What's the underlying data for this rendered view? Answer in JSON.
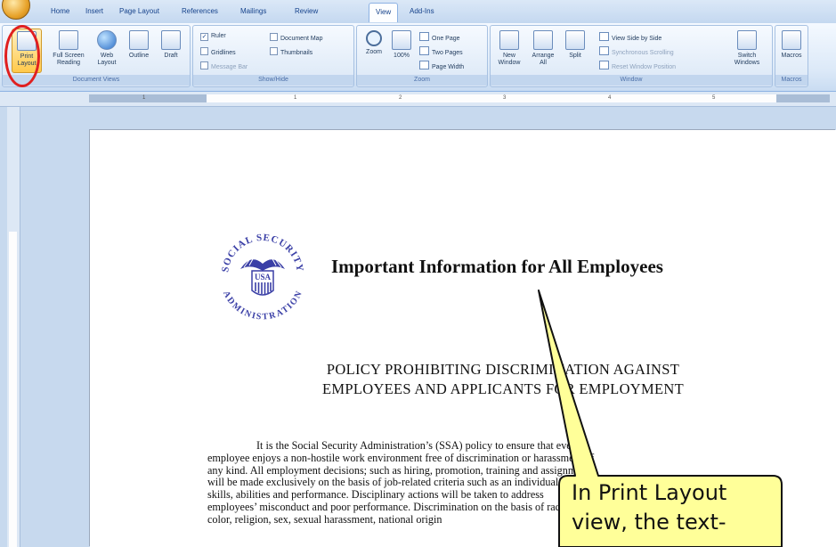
{
  "ribbon": {
    "tabs": [
      "Home",
      "Insert",
      "Page Layout",
      "References",
      "Mailings",
      "Review",
      "View",
      "Add-Ins"
    ],
    "active_tab": "View",
    "document_views": {
      "label": "Document Views",
      "buttons": [
        "Print Layout",
        "Full Screen Reading",
        "Web Layout",
        "Outline",
        "Draft"
      ]
    },
    "show_hide": {
      "label": "Show/Hide",
      "items": [
        {
          "label": "Ruler",
          "checked": true
        },
        {
          "label": "Gridlines",
          "checked": false
        },
        {
          "label": "Message Bar",
          "checked": false
        },
        {
          "label": "Document Map",
          "checked": false
        },
        {
          "label": "Thumbnails",
          "checked": false
        }
      ]
    },
    "zoom": {
      "label": "Zoom",
      "zoom_button": "Zoom",
      "hundred_button": "100%",
      "one_page": "One Page",
      "two_pages": "Two Pages",
      "page_width": "Page Width"
    },
    "window": {
      "label": "Window",
      "new_window": "New Window",
      "arrange_all": "Arrange All",
      "split": "Split",
      "view_side_by_side": "View Side by Side",
      "synchronous_scrolling": "Synchronous Scrolling",
      "reset_window_position": "Reset Window Position",
      "switch_windows": "Switch Windows"
    },
    "macros": {
      "label": "Macros",
      "button": "Macros"
    }
  },
  "ruler": {
    "numbers": [
      "1",
      "1",
      "2",
      "3",
      "4",
      "5"
    ]
  },
  "document": {
    "seal": {
      "arc_top": "SOCIAL SECURITY",
      "arc_bottom": "ADMINISTRATION",
      "center": "USA"
    },
    "title": "Important Information for All Employees",
    "policy_line1": "POLICY PROHIBITING DISCRIMINATION AGAINST",
    "policy_line2": "EMPLOYEES AND APPLICANTS FOR EMPLOYMENT",
    "body_lines": [
      "It is the Social Security Administration’s (SSA) policy to ensure that every",
      "employee enjoys a non-hostile work environment free of discrimination or harassment of",
      "any kind. All employment decisions; such as hiring, promotion, training and assignment",
      "will be made exclusively on the basis of job-related criteria such as an individual’s",
      "skills, abilities and performance. Disciplinary actions will be taken to address",
      "employees’ misconduct and poor performance. Discrimination on the basis of race,",
      "color, religion, sex, sexual harassment, national origin"
    ]
  },
  "callout": {
    "line1": "In Print Layout",
    "line2": "view, the text-"
  },
  "colors": {
    "highlight_circle": "#e02020",
    "callout_fill": "#ffff99",
    "ribbon_text": "#15428b"
  }
}
